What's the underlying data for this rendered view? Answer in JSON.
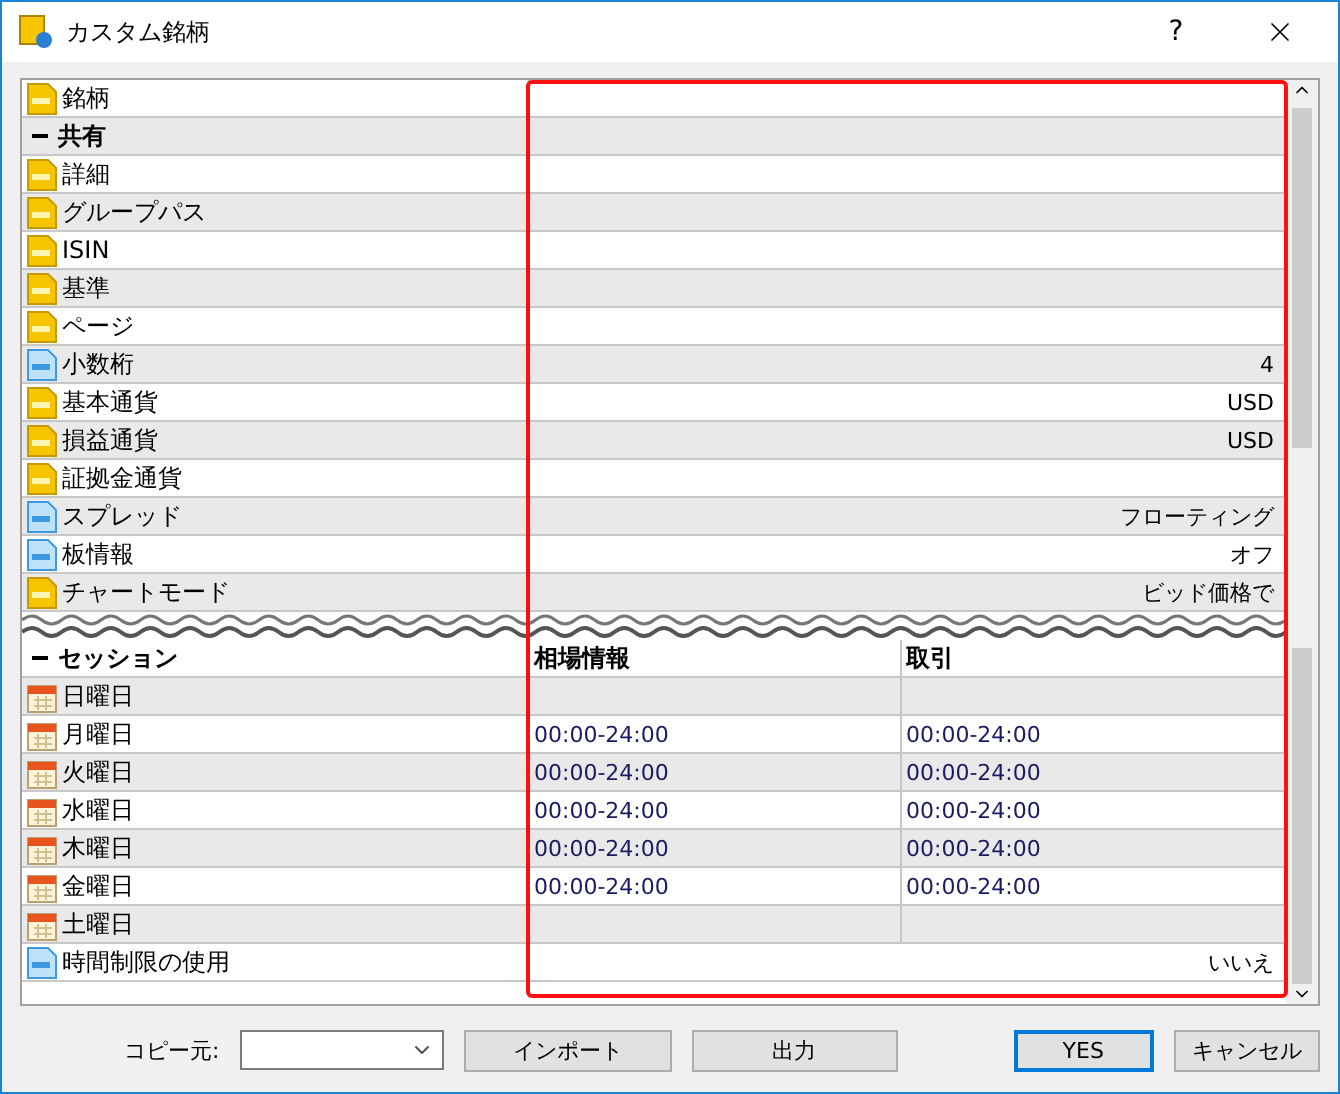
{
  "window": {
    "title": "カスタム銘柄",
    "help": "?"
  },
  "top_rows": [
    {
      "kind": "text",
      "label": "銘柄",
      "value": ""
    },
    {
      "kind": "group",
      "label": "共有",
      "expanded": true
    },
    {
      "kind": "text",
      "label": "詳細",
      "value": ""
    },
    {
      "kind": "text",
      "label": "グループパス",
      "value": ""
    },
    {
      "kind": "text",
      "label": "ISIN",
      "value": ""
    },
    {
      "kind": "text",
      "label": "基準",
      "value": ""
    },
    {
      "kind": "text",
      "label": "ページ",
      "value": ""
    },
    {
      "kind": "number",
      "label": "小数桁",
      "value": "4"
    },
    {
      "kind": "text",
      "label": "基本通貨",
      "value": "USD"
    },
    {
      "kind": "text",
      "label": "損益通貨",
      "value": "USD"
    },
    {
      "kind": "text",
      "label": "証拠金通貨",
      "value": ""
    },
    {
      "kind": "number",
      "label": "スプレッド",
      "value": "フローティング"
    },
    {
      "kind": "number",
      "label": "板情報",
      "value": "オフ"
    },
    {
      "kind": "text",
      "label": "チャートモード",
      "value": "ビッド価格で"
    }
  ],
  "session": {
    "label": "セッション",
    "expanded": true,
    "columns": [
      "相場情報",
      "取引"
    ],
    "rows": [
      {
        "day": "日曜日",
        "quotes": "",
        "trade": ""
      },
      {
        "day": "月曜日",
        "quotes": "00:00-24:00",
        "trade": "00:00-24:00"
      },
      {
        "day": "火曜日",
        "quotes": "00:00-24:00",
        "trade": "00:00-24:00"
      },
      {
        "day": "水曜日",
        "quotes": "00:00-24:00",
        "trade": "00:00-24:00"
      },
      {
        "day": "木曜日",
        "quotes": "00:00-24:00",
        "trade": "00:00-24:00"
      },
      {
        "day": "金曜日",
        "quotes": "00:00-24:00",
        "trade": "00:00-24:00"
      },
      {
        "day": "土曜日",
        "quotes": "",
        "trade": ""
      }
    ]
  },
  "bottom_rows": [
    {
      "kind": "number",
      "label": "時間制限の使用",
      "value": "いいえ"
    }
  ],
  "footer": {
    "copy_label": "コピー元:",
    "buttons": [
      {
        "label": "インポート",
        "default": false
      },
      {
        "label": "出力",
        "default": false
      },
      {
        "label": "YES",
        "default": true
      },
      {
        "label": "キャンセル",
        "default": false
      }
    ]
  }
}
